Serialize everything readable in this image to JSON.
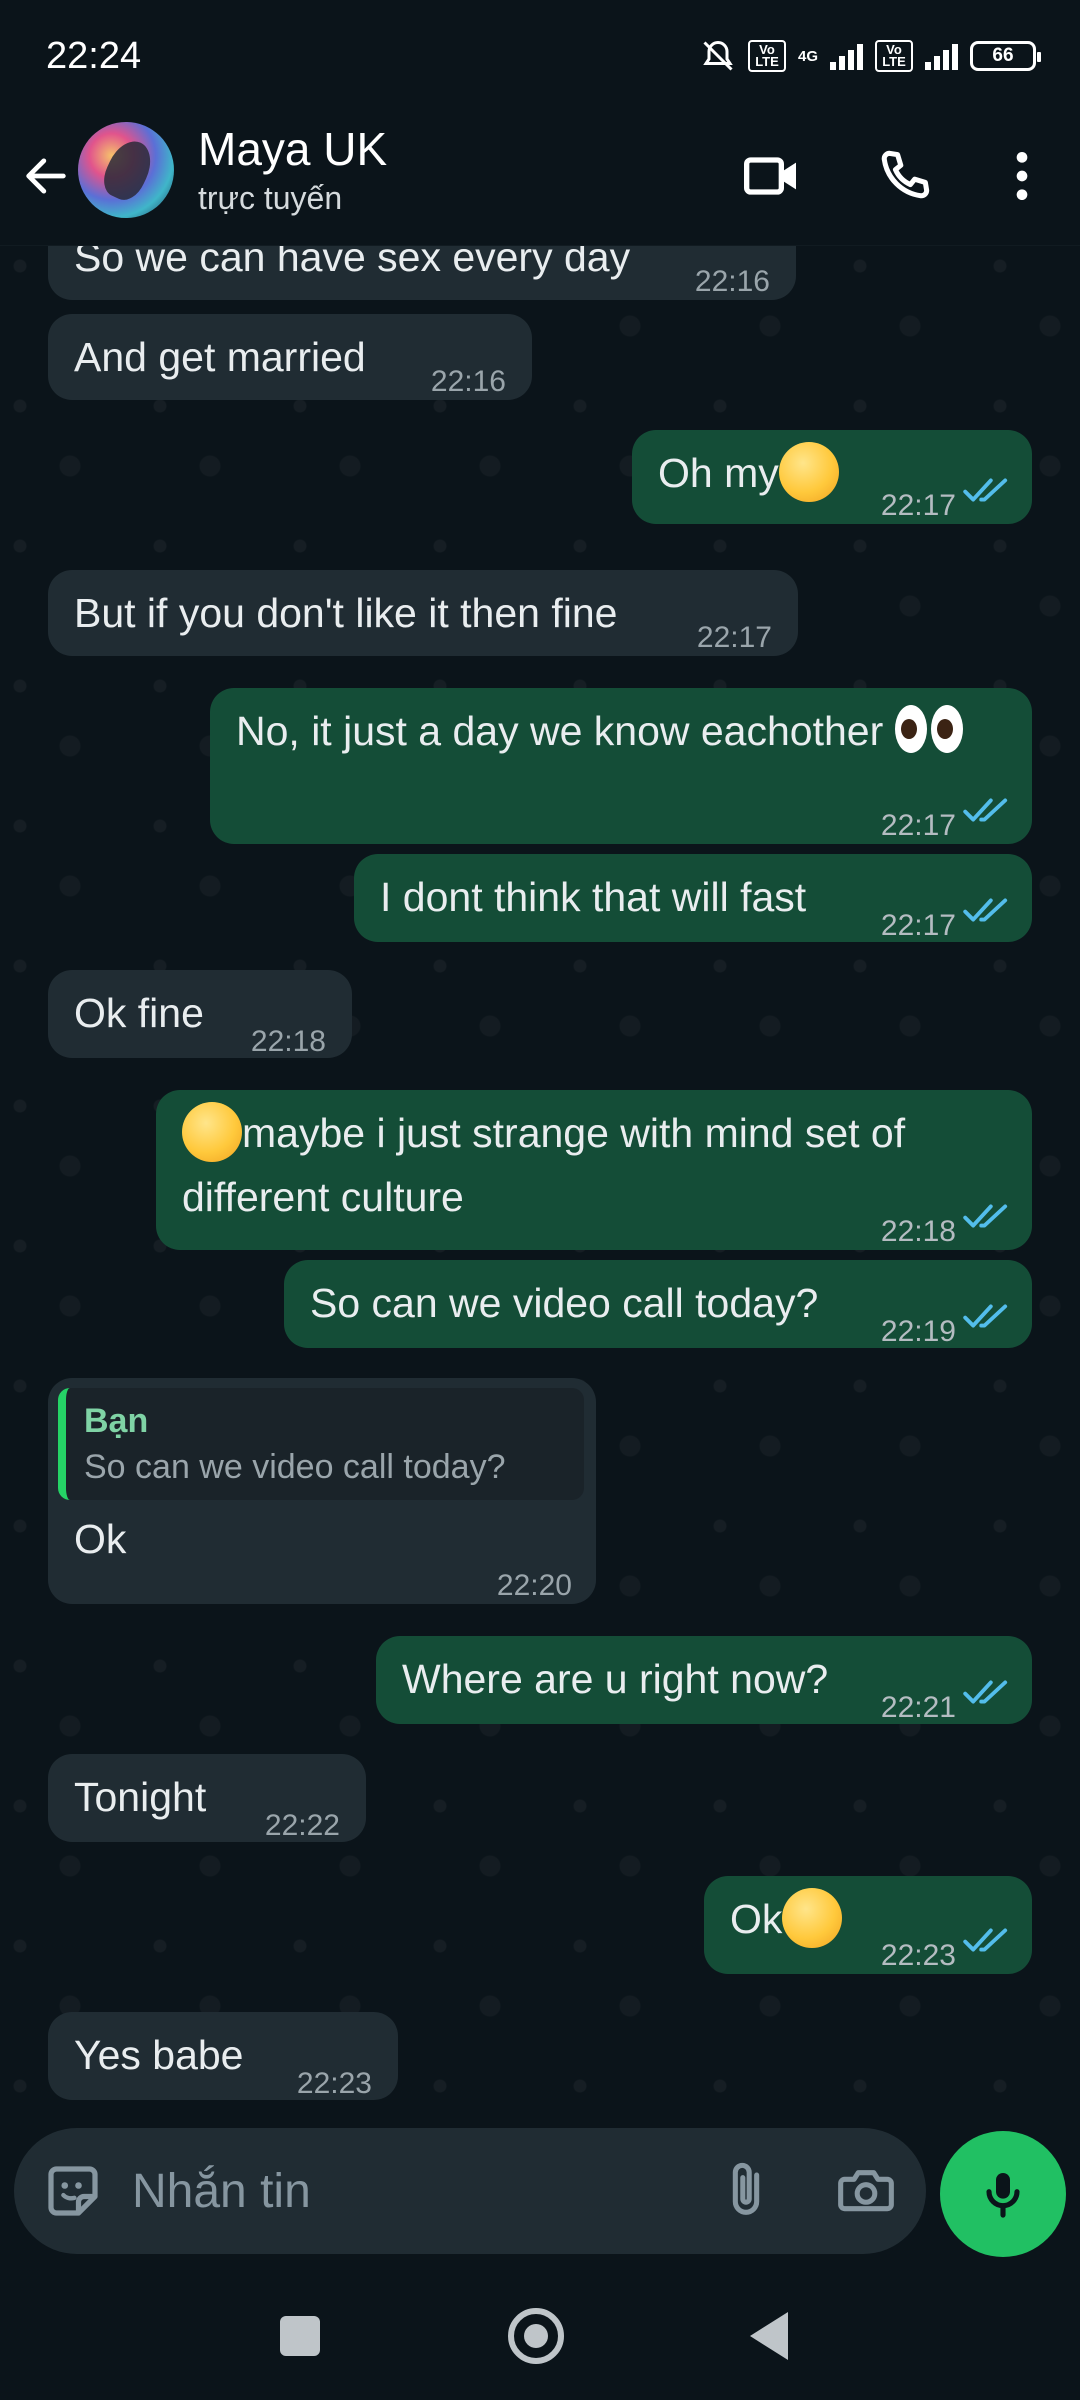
{
  "status_bar": {
    "time": "22:24",
    "volte1": "Vo LTE",
    "network": "4G",
    "volte2": "Vo LTE",
    "battery": "66"
  },
  "header": {
    "contact_name": "Maya UK",
    "contact_status": "trực tuyến"
  },
  "messages": [
    {
      "dir": "in",
      "text": "So we can have sex every day",
      "time": "22:16"
    },
    {
      "dir": "in",
      "text": "And get married",
      "time": "22:16"
    },
    {
      "dir": "out",
      "text": "Oh my",
      "emoji": "savoring-food-emoji",
      "time": "22:17"
    },
    {
      "dir": "in",
      "text": "But if you don't like it then fine",
      "time": "22:17"
    },
    {
      "dir": "out",
      "text": "No, it just a day we know eachother",
      "emoji": "eyes-emoji",
      "time": "22:17"
    },
    {
      "dir": "out",
      "text": "I dont think that will fast",
      "time": "22:17"
    },
    {
      "dir": "in",
      "text": "Ok fine",
      "time": "22:18"
    },
    {
      "dir": "out",
      "emoji": "thinking-face-emoji",
      "text_line1": "maybe i just strange with mind set of",
      "text_line2": "different culture",
      "time": "22:18"
    },
    {
      "dir": "out",
      "text": "So can we video call today?",
      "time": "22:19"
    },
    {
      "dir": "in",
      "reply_name": "Bạn",
      "reply_text": "So can we video call today?",
      "text": "Ok",
      "time": "22:20"
    },
    {
      "dir": "out",
      "text": "Where are u right now?",
      "time": "22:21"
    },
    {
      "dir": "in",
      "text": "Tonight",
      "time": "22:22"
    },
    {
      "dir": "out",
      "text": "Ok",
      "emoji": "upside-down-face-emoji",
      "time": "22:23"
    },
    {
      "dir": "in",
      "text": "Yes babe",
      "time": "22:23"
    }
  ],
  "input_bar": {
    "placeholder": "Nhắn tin"
  },
  "colors": {
    "background": "#0b141a",
    "incoming_bubble": "#202c33",
    "outgoing_bubble": "#144d37",
    "read_ticks": "#53bdeb",
    "mic_button": "#21c063"
  }
}
